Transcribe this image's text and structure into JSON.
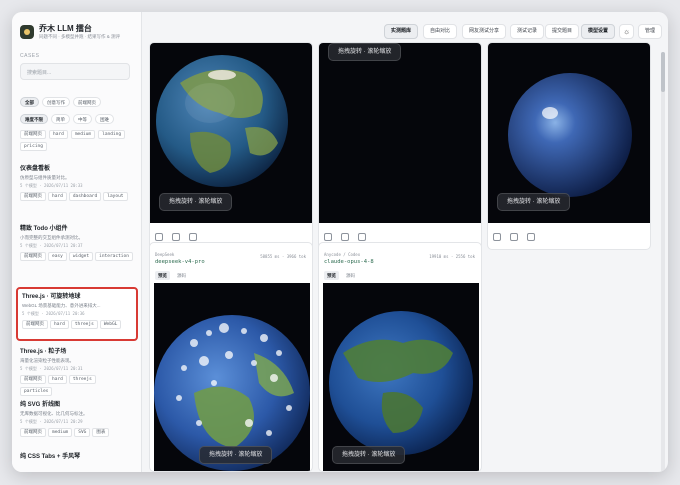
{
  "app": {
    "title": "乔木 LLM 擂台",
    "subtitle": "同题不同 · 多模型并跑 · 结果写作 & 测评"
  },
  "sidebar": {
    "section_label": "CASES",
    "search_placeholder": "搜索题目...",
    "filters_row1": [
      "全部",
      "创意写作",
      "前端网页"
    ],
    "filters_row2": [
      "难度不限",
      "简单",
      "中等",
      "困难"
    ],
    "top_tags": [
      [
        "前端网页",
        "hard",
        "medium",
        "landing"
      ],
      [
        "pricing"
      ]
    ],
    "cases": [
      {
        "title": "仪表盘看板",
        "desc": "仿原型与组件质量对比。",
        "meta": "5 个模型 · 2026/07/11 20:33",
        "tags": [
          "前端网页",
          "hard",
          "dashboard",
          "layout"
        ]
      },
      {
        "title": "精致 Todo 小组件",
        "desc": "小而完整的交互组件承测对比。",
        "meta": "5 个模型 · 2026/07/11 20:37",
        "tags": [
          "前端网页",
          "easy",
          "widget",
          "interaction"
        ]
      },
      {
        "title": "Three.js · 可旋转地球",
        "desc": "WebGL 场景基础能力、意外进来排大...",
        "meta": "5 个模型 · 2026/07/11 20:36",
        "tags": [
          "前端网页",
          "hard",
          "threejs",
          "WebGL"
        ]
      },
      {
        "title": "Three.js · 粒子场",
        "desc": "海量化渲染粒子性能表现。",
        "meta": "5 个模型 · 2026/07/11 20:31",
        "tags": [
          "前端网页",
          "hard",
          "threejs",
          "particles"
        ]
      },
      {
        "title": "纯 SVG 折线图",
        "desc": "无库数据可视化、比几何与标注。",
        "meta": "5 个模型 · 2026/07/11 20:29",
        "tags": [
          "前端网页",
          "medium",
          "SVG",
          "图表"
        ]
      },
      {
        "title": "纯 CSS Tabs + 手风琴",
        "desc": "",
        "meta": "",
        "tags": []
      }
    ]
  },
  "nav": {
    "items": [
      "实测题库",
      "自由对比",
      "网友测试分享",
      "测试记录",
      "提交题目",
      "模型设置"
    ],
    "active_index": 0,
    "manage_label": "管理",
    "theme_icon": "sun-icon"
  },
  "hints": {
    "drag_hint": "拖拽旋转 · 滚轮缩放"
  },
  "panels": {
    "tab_preview": "预览",
    "tab_source": "源码",
    "bottom_left": {
      "provider": "DeepSeek",
      "model": "deepseek-v4-pro",
      "stats": "58855 ms · 3966 tok"
    },
    "bottom_mid": {
      "provider": "Anycode / Codex",
      "model": "claude-opus-4-8",
      "stats": "19910 ms · 2556 tok"
    }
  },
  "colors": {
    "accent_green": "#2c6b4f",
    "highlight_red": "#d83a34"
  }
}
